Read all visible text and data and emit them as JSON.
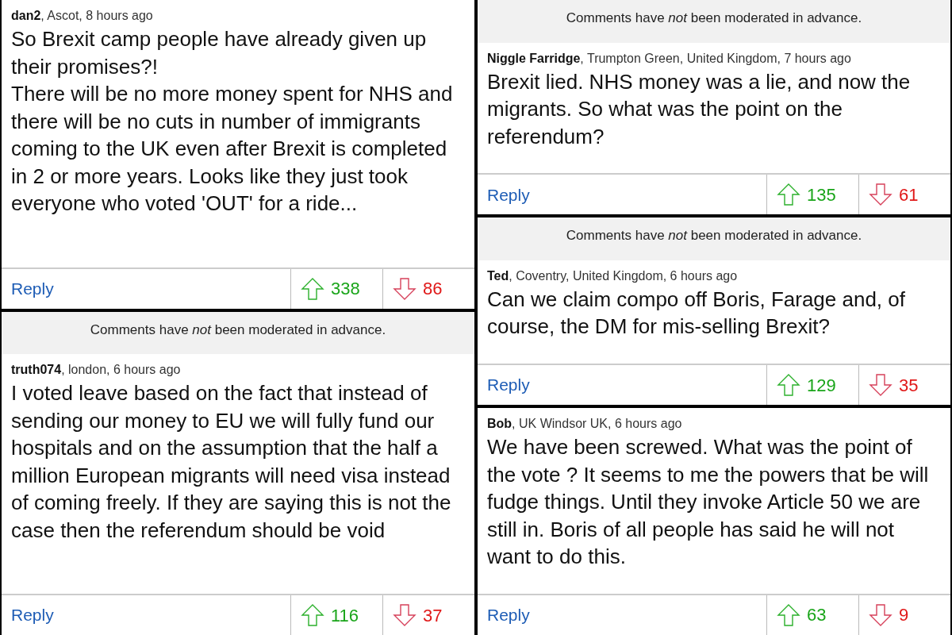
{
  "columns": [
    {
      "panels": [
        {
          "author": "dan2",
          "meta": ", Ascot, 8 hours ago",
          "body": "So Brexit camp people have already given up their promises?!\nThere will be no more money spent for NHS and there will be no cuts in number of immigrants coming to the UK even after Brexit is completed in 2 or more years. Looks like they just took everyone who voted 'OUT' for a ride...",
          "reply": "Reply",
          "upvotes": "338",
          "downvotes": "86"
        },
        {
          "notice": "Comments have *not* been moderated in advance.",
          "author": "truth074",
          "meta": ", london, 6 hours ago",
          "body": "I voted leave based on the fact that instead of sending our money to EU we will fully fund our hospitals and on the assumption that the half a million European migrants will need visa instead of coming freely.  If they are saying this is not the case then the referendum should be void",
          "reply": "Reply",
          "upvotes": "116",
          "downvotes": "37"
        }
      ]
    },
    {
      "panels": [
        {
          "notice": "Comments have *not* been moderated in advance.",
          "author": "Niggle Farridge",
          "meta": ", Trumpton Green, United Kingdom, 7 hours ago",
          "body": "Brexit lied. NHS money was a lie, and now the migrants. So what was the point on the referendum?",
          "reply": "Reply",
          "upvotes": "135",
          "downvotes": "61"
        },
        {
          "notice": "Comments have *not* been moderated in advance.",
          "author": "Ted",
          "meta": ", Coventry, United Kingdom, 6 hours ago",
          "body": "Can we claim compo off Boris, Farage and, of course, the DM for mis-selling Brexit?",
          "reply": "Reply",
          "upvotes": "129",
          "downvotes": "35"
        },
        {
          "author": "Bob",
          "meta": ", UK Windsor UK, 6 hours ago",
          "body": "We have been screwed. What was the point of the vote ? It seems to me the powers that be will fudge things. Until they invoke Article 50 we are still in. Boris of all people has said he will not want to do this.",
          "reply": "Reply",
          "upvotes": "63",
          "downvotes": "9"
        }
      ]
    }
  ]
}
